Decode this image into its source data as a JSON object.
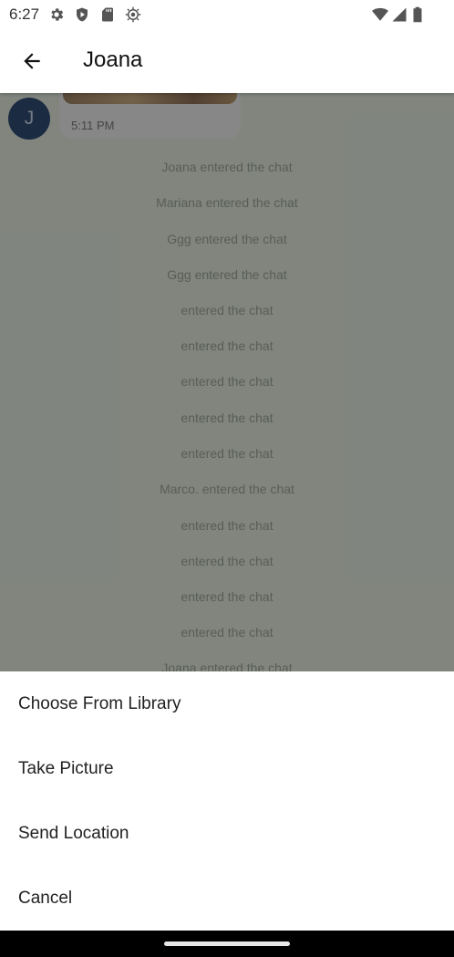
{
  "status_bar": {
    "time": "6:27",
    "left_icons": [
      "settings-gear",
      "shield",
      "sd-card",
      "sun-badge"
    ],
    "right_icons": [
      "wifi",
      "cellular-signal",
      "battery"
    ]
  },
  "app_bar": {
    "back_icon": "arrow-left",
    "title": "Joana"
  },
  "chat": {
    "avatar_initial": "J",
    "last_message_time": "5:11 PM",
    "system_messages": [
      "Joana entered the chat",
      "Mariana entered the chat",
      "Ggg entered the chat",
      "Ggg entered the chat",
      "entered the chat",
      "entered the chat",
      "entered the chat",
      "entered the chat",
      "entered the chat",
      "Marco. entered the chat",
      "entered the chat",
      "entered the chat",
      "entered the chat",
      "entered the chat",
      "Joana entered the chat"
    ]
  },
  "sheet": {
    "options": [
      "Choose From Library",
      "Take Picture",
      "Send Location",
      "Cancel"
    ]
  },
  "colors": {
    "chat_background": "#dfe6da",
    "scrim": "rgba(0,0,0,0.42)",
    "avatar": "#2f4a70",
    "nav_bar": "#000000"
  }
}
